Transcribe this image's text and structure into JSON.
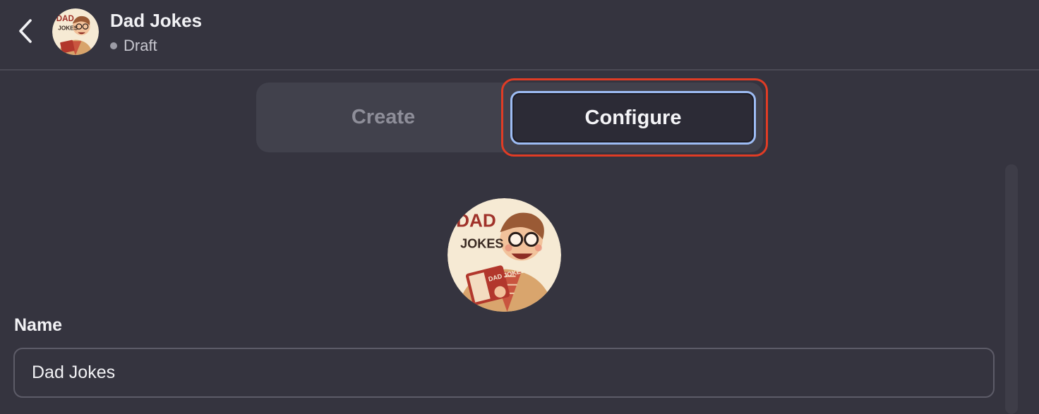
{
  "header": {
    "title": "Dad Jokes",
    "status": "Draft",
    "back_icon": "chevron-left-icon"
  },
  "tabs": {
    "create_label": "Create",
    "configure_label": "Configure",
    "selected": "Configure"
  },
  "avatar": {
    "badge_line1": "DAD",
    "badge_line2": "JOKES",
    "book_text": "DAD JOKES"
  },
  "form": {
    "name_label": "Name",
    "name_value": "Dad Jokes"
  },
  "colors": {
    "background": "#35343f",
    "highlight": "#e03c25",
    "focus_ring": "#9dbcf4"
  }
}
